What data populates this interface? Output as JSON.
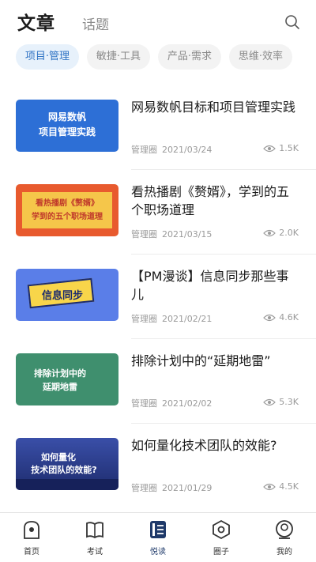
{
  "header": {
    "tab_active": "文章",
    "tab_other": "话题"
  },
  "chips": [
    "项目·管理",
    "敏捷·工具",
    "产品·需求",
    "思维·效率"
  ],
  "articles": [
    {
      "thumb_lines": [
        "网易数帆",
        "项目管理实践"
      ],
      "thumb_bg": "#2d6fd6",
      "title": "网易数帆目标和项目管理实践",
      "source": "管理圈",
      "date": "2021/03/24",
      "views": "1.5K"
    },
    {
      "thumb_lines": [
        "看热播剧《赘婿》",
        "学到的五个职场道理"
      ],
      "thumb_bg": "#e85a2e",
      "title": "看热播剧《赘婿》，学到的五个职场道理",
      "source": "管理圈",
      "date": "2021/03/15",
      "views": "2.0K"
    },
    {
      "thumb_lines": [
        "信息同步"
      ],
      "thumb_bg": "#5a7ee8",
      "title": "【PM漫谈】信息同步那些事儿",
      "source": "管理圈",
      "date": "2021/02/21",
      "views": "4.6K"
    },
    {
      "thumb_lines": [
        "排除计划中的",
        "延期地雷"
      ],
      "thumb_bg": "#3f8f6e",
      "title": "排除计划中的“延期地雷”",
      "source": "管理圈",
      "date": "2021/02/02",
      "views": "5.3K"
    },
    {
      "thumb_lines": [
        "如何量化",
        "技术团队的效能?"
      ],
      "thumb_bg": "#2a3f8c",
      "title": "如何量化技术团队的效能?",
      "source": "管理圈",
      "date": "2021/01/29",
      "views": "4.5K"
    }
  ],
  "nav": [
    {
      "label": "首页",
      "icon": "home-icon"
    },
    {
      "label": "考试",
      "icon": "book-icon"
    },
    {
      "label": "悦读",
      "icon": "reading-icon"
    },
    {
      "label": "圈子",
      "icon": "hexagon-icon"
    },
    {
      "label": "我的",
      "icon": "profile-icon"
    }
  ],
  "colors": {
    "accent": "#2f73c4",
    "chip_active_bg": "#e7f1fb",
    "nav_active": "#1f3a6a"
  }
}
